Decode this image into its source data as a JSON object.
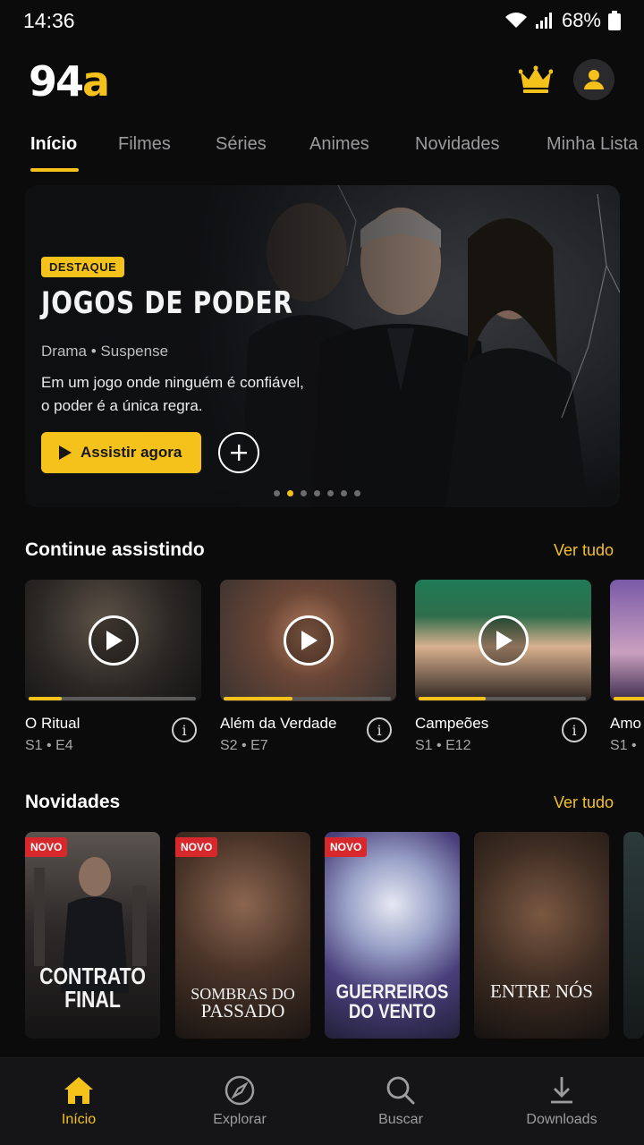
{
  "status_bar": {
    "time": "14:36",
    "battery": "68%"
  },
  "header": {
    "logo_number": "94",
    "logo_letter": "a"
  },
  "tabs": [
    {
      "label": "Início",
      "active": true
    },
    {
      "label": "Filmes"
    },
    {
      "label": "Séries"
    },
    {
      "label": "Animes"
    },
    {
      "label": "Novidades"
    },
    {
      "label": "Minha Lista"
    }
  ],
  "hero": {
    "badge": "DESTAQUE",
    "title": "JOGOS DE PODER",
    "genres": "Drama • Suspense",
    "description": "Em um jogo onde ninguém é confiável, o poder é a única regra.",
    "watch_label": "Assistir agora",
    "slide_count": 7,
    "active_slide": 2
  },
  "continue_watching": {
    "title": "Continue assistindo",
    "see_all": "Ver tudo",
    "items": [
      {
        "title": "O Ritual",
        "episode": "S1 • E4",
        "progress": 0.2
      },
      {
        "title": "Além da Verdade",
        "episode": "S2 • E7",
        "progress": 0.41
      },
      {
        "title": "Campeões",
        "episode": "S1 • E12",
        "progress": 0.4
      },
      {
        "title": "Amo",
        "episode": "S1 •",
        "progress": 0.3
      }
    ]
  },
  "new_releases": {
    "title": "Novidades",
    "see_all": "Ver tudo",
    "badge": "NOVO",
    "items": [
      {
        "line1": "CONTRATO",
        "line2": "FINAL",
        "is_new": true
      },
      {
        "line1": "SOMBRAS DO",
        "line2": "PASSADO",
        "is_new": true
      },
      {
        "line1": "GUERREIROS",
        "line2": "DO VENTO",
        "is_new": true
      },
      {
        "line1": "ENTRE NÓS",
        "line2": "",
        "is_new": false
      }
    ]
  },
  "bottom_nav": [
    {
      "label": "Início",
      "icon": "home-icon",
      "active": true
    },
    {
      "label": "Explorar",
      "icon": "compass-icon"
    },
    {
      "label": "Buscar",
      "icon": "search-icon"
    },
    {
      "label": "Downloads",
      "icon": "download-icon"
    }
  ],
  "colors": {
    "accent": "#f5c21b",
    "background": "#0b0b0c",
    "new_badge": "#d7282c"
  }
}
